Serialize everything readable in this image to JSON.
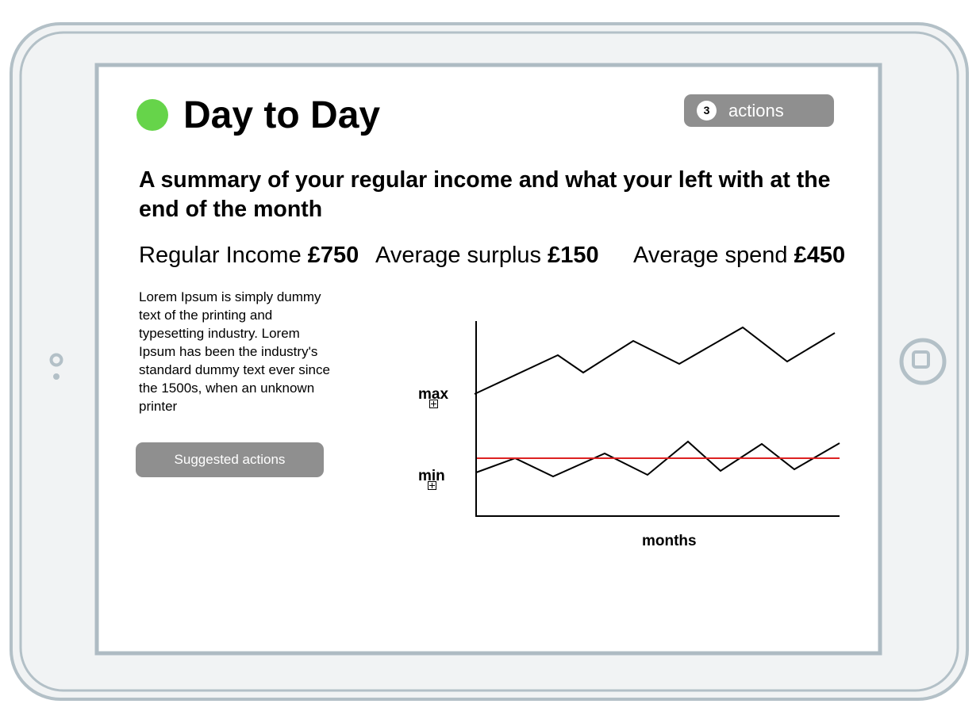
{
  "header": {
    "title": "Day to Day",
    "status_color": "#66d44a",
    "actions": {
      "count": "3",
      "label": "actions"
    }
  },
  "summary": "A summary of your regular income and what your left with at the end of the month",
  "stats": [
    {
      "label": "Regular Income",
      "value": "£750"
    },
    {
      "label": "Average surplus",
      "value": "£150"
    },
    {
      "label": "Average spend",
      "value": "£450"
    }
  ],
  "body_text": "Lorem Ipsum is simply dummy text of the printing and typesetting industry. Lorem Ipsum has been the industry's standard dummy text ever since the 1500s, when an unknown printer",
  "suggested_actions_label": "Suggested actions",
  "chart": {
    "y_max_label": "max",
    "y_min_label": "min",
    "x_label": "months",
    "reference_color": "#dd2222"
  }
}
